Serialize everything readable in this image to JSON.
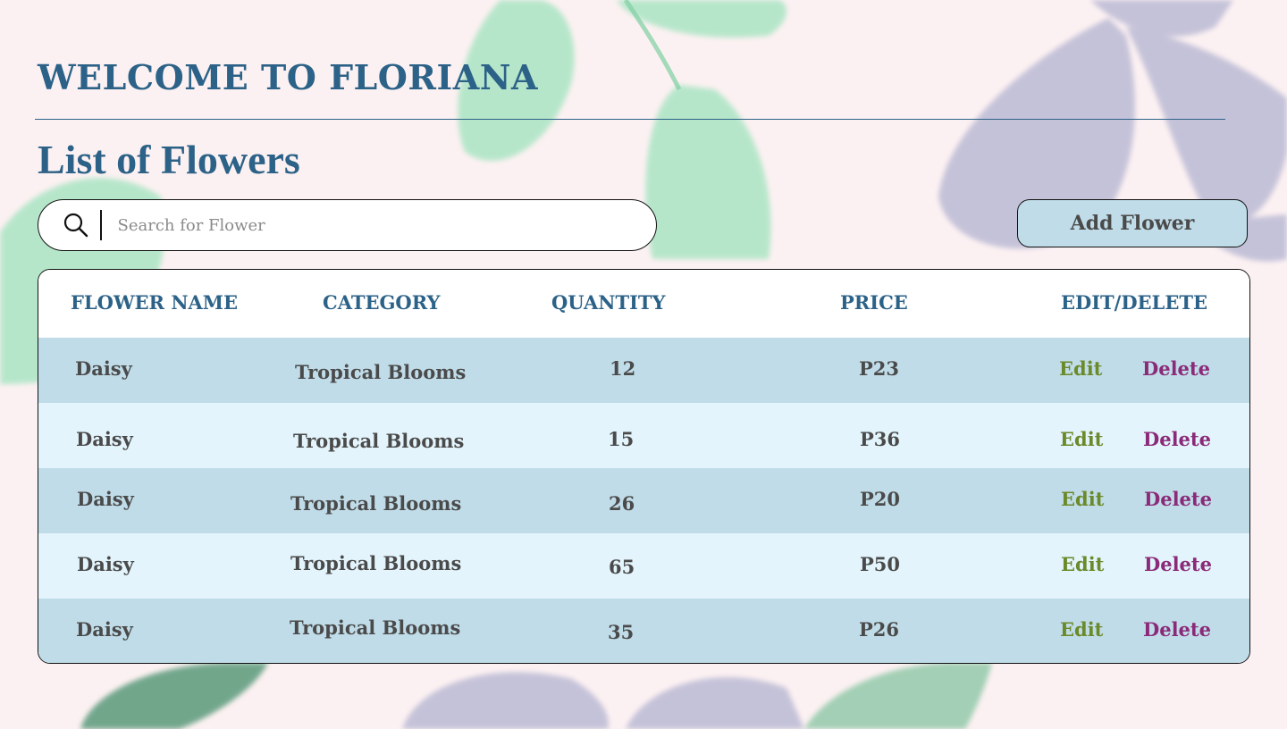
{
  "app": {
    "welcome_title": "WELCOME TO FLORIANA",
    "page_subtitle": "List of Flowers"
  },
  "search": {
    "placeholder": "Search for Flower",
    "value": "",
    "icon": "search-icon"
  },
  "toolbar": {
    "add_label": "Add Flower"
  },
  "table": {
    "headers": {
      "name": "FLOWER NAME",
      "category": "CATEGORY",
      "quantity": "QUANTITY",
      "price": "PRICE",
      "actions": "EDIT/DELETE"
    },
    "rows": [
      {
        "name": "Daisy",
        "category": "Tropical Blooms",
        "quantity": "12",
        "price": "P23",
        "edit": "Edit",
        "delete": "Delete"
      },
      {
        "name": "Daisy",
        "category": "Tropical Blooms",
        "quantity": "15",
        "price": "P36",
        "edit": "Edit",
        "delete": "Delete"
      },
      {
        "name": "Daisy",
        "category": "Tropical Blooms",
        "quantity": "26",
        "price": "P20",
        "edit": "Edit",
        "delete": "Delete"
      },
      {
        "name": "Daisy",
        "category": "Tropical Blooms",
        "quantity": "65",
        "price": "P50",
        "edit": "Edit",
        "delete": "Delete"
      },
      {
        "name": "Daisy",
        "category": "Tropical Blooms",
        "quantity": "35",
        "price": "P26",
        "edit": "Edit",
        "delete": "Delete"
      }
    ]
  },
  "colors": {
    "accent": "#2c6288",
    "row_dark": "#c0dce8",
    "row_light": "#e3f4fc",
    "edit": "#6b8a2a",
    "delete": "#8a2a78",
    "background": "#fcf1f2"
  }
}
